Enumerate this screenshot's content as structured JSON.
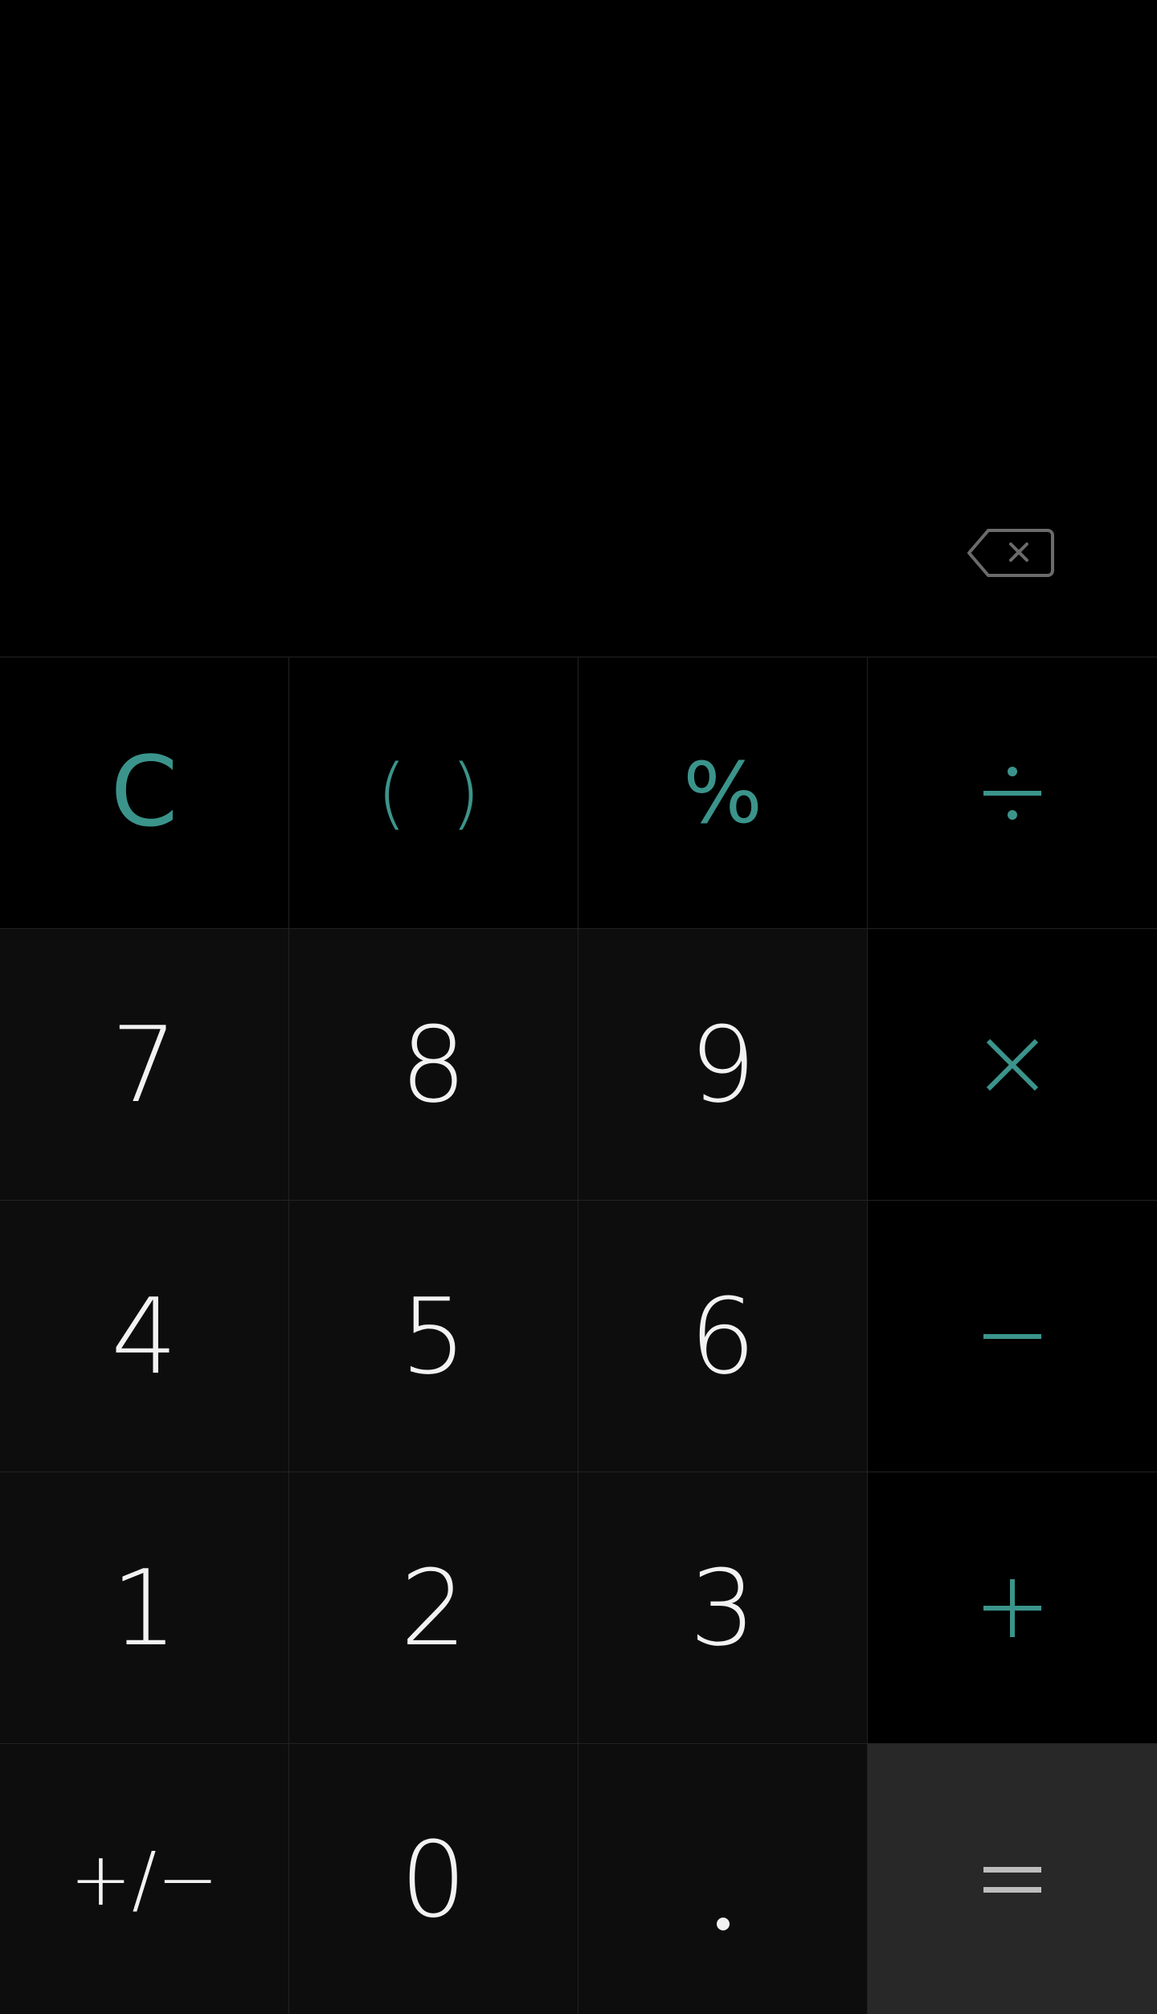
{
  "colors": {
    "accent": "#3b948b",
    "background": "#000000",
    "digit_key_bg": "#0d0d0d",
    "equals_key_bg": "#282828",
    "digit_text": "#f2f2f2"
  },
  "display": {
    "backspace_icon": "backspace-icon"
  },
  "keys": {
    "clear": "C",
    "parentheses": "( )",
    "percent": "%",
    "divide": "÷",
    "seven": "7",
    "eight": "8",
    "nine": "9",
    "multiply": "×",
    "four": "4",
    "five": "5",
    "six": "6",
    "subtract": "−",
    "one": "1",
    "two": "2",
    "three": "3",
    "add": "+",
    "plus_minus": "+/−",
    "zero": "0",
    "decimal": ".",
    "equals": "="
  }
}
